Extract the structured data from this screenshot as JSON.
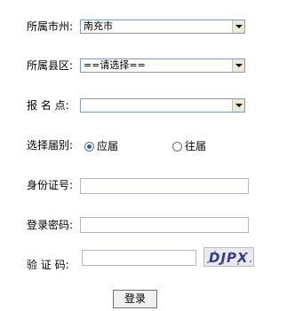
{
  "form": {
    "city": {
      "label": "所属市州:",
      "value": "南充市"
    },
    "county": {
      "label": "所属县区:",
      "value": "==请选择=="
    },
    "site": {
      "label": "报 名 点:",
      "value": ""
    },
    "session": {
      "label": "选择届别:",
      "options": [
        {
          "label": "应届",
          "checked": true
        },
        {
          "label": "往届",
          "checked": false
        }
      ]
    },
    "id_number": {
      "label": "身份证号:",
      "value": ""
    },
    "password": {
      "label": "登录密码:",
      "value": ""
    },
    "captcha": {
      "label": "验 证 码:",
      "value": "",
      "image_text": "DJPX"
    },
    "submit_label": "登录"
  }
}
